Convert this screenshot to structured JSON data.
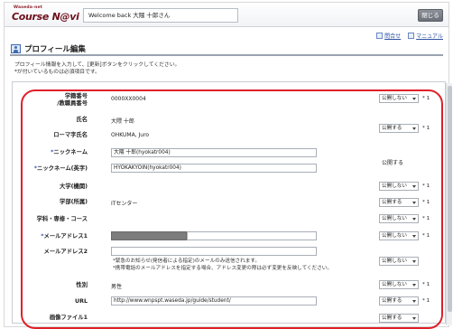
{
  "header": {
    "logo_small": "Waseda-net",
    "logo_main": "Course N@vi",
    "welcome": "Welcome back 大隈 十郎さん",
    "close_label": "閉じる"
  },
  "help": {
    "inquiry": "問合せ",
    "manual": "マニュアル"
  },
  "page": {
    "title": "プロフィール編集",
    "instruction_1": "プロフィール情報を入力して、[更新]ボタンをクリックしてください。",
    "instruction_2": "*が付いているものは必須項目です。"
  },
  "form": {
    "student_id": {
      "label_1": "学籍番号",
      "label_2": "/教職員番号",
      "value": "0000XX0004",
      "visibility": "公開しない",
      "star": "* 1"
    },
    "name": {
      "label": "氏名",
      "value": "大隈 十郎",
      "visibility": "公開する",
      "star": "* 1"
    },
    "romaji": {
      "label": "ローマ字氏名",
      "value": "OHKUMA, Juro"
    },
    "nickname": {
      "req": "*",
      "label": "ニックネーム",
      "value": "大隈 十郎(hyokatr004)"
    },
    "nickname_en": {
      "req": "*",
      "label": "ニックネーム(英字)",
      "value": "HYOKAKYOIN(hyokatr004)",
      "static_visibility": "公開する"
    },
    "university": {
      "label": "大学(機関)",
      "visibility": "公開しない",
      "star": "* 1"
    },
    "faculty": {
      "label": "学部(所属)",
      "value": "ITセンター",
      "visibility": "公開する",
      "star": "* 1"
    },
    "department": {
      "label": "学科・専修・コース",
      "visibility": "公開しない",
      "star": "* 1"
    },
    "email1": {
      "req": "*",
      "label": "メールアドレス1",
      "visibility": "公開しない",
      "star": "* 1"
    },
    "email2": {
      "label": "メールアドレス2",
      "visibility": "公開しない"
    },
    "email_note_1": "*緊急のお知らせ(発信者による指定)のメールのみ送信されます。",
    "email_note_2": "*携帯電話のメールアドレスを指定する場合、アドレス変更の際は必ず変更を反映してください。",
    "gender": {
      "label": "性別",
      "value": "男性",
      "visibility": "公開しない",
      "star": "* 1"
    },
    "url": {
      "label": "URL",
      "value": "http://www.wnpspt.waseda.jp/guide/student/",
      "visibility": "公開する",
      "star": "* 1"
    },
    "image": {
      "label": "画像ファイル1",
      "visibility": "公開する"
    }
  },
  "colors": {
    "highlight_outline": "#e0202a",
    "required_mark": "#3a57b8",
    "logo": "#6d0f1a"
  }
}
